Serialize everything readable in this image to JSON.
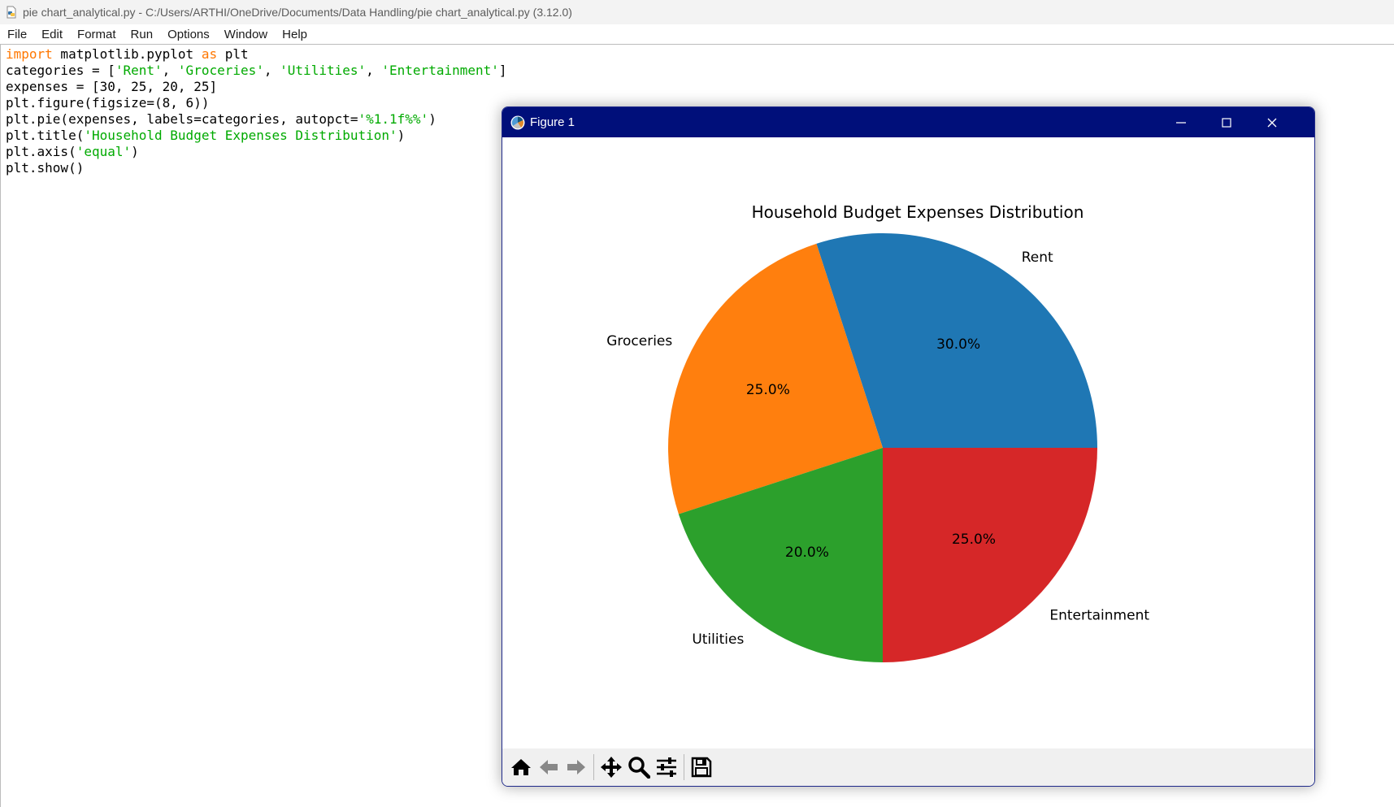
{
  "window": {
    "title": "pie chart_analytical.py - C:/Users/ARTHI/OneDrive/Documents/Data Handling/pie chart_analytical.py (3.12.0)"
  },
  "menu": {
    "items": [
      "File",
      "Edit",
      "Format",
      "Run",
      "Options",
      "Window",
      "Help"
    ]
  },
  "editor": {
    "lines": [
      [
        {
          "t": "import",
          "c": "kw"
        },
        {
          "t": " matplotlib.pyplot ",
          "c": ""
        },
        {
          "t": "as",
          "c": "kw"
        },
        {
          "t": " plt",
          "c": ""
        }
      ],
      [
        {
          "t": "categories = [",
          "c": ""
        },
        {
          "t": "'Rent'",
          "c": "str"
        },
        {
          "t": ", ",
          "c": ""
        },
        {
          "t": "'Groceries'",
          "c": "str"
        },
        {
          "t": ", ",
          "c": ""
        },
        {
          "t": "'Utilities'",
          "c": "str"
        },
        {
          "t": ", ",
          "c": ""
        },
        {
          "t": "'Entertainment'",
          "c": "str"
        },
        {
          "t": "]",
          "c": ""
        }
      ],
      [
        {
          "t": "expenses = [30, 25, 20, 25]",
          "c": ""
        }
      ],
      [
        {
          "t": "plt.figure(figsize=(8, 6))",
          "c": ""
        }
      ],
      [
        {
          "t": "plt.pie(expenses, labels=categories, autopct=",
          "c": ""
        },
        {
          "t": "'%1.1f%%'",
          "c": "str"
        },
        {
          "t": ")",
          "c": ""
        }
      ],
      [
        {
          "t": "plt.title(",
          "c": ""
        },
        {
          "t": "'Household Budget Expenses Distribution'",
          "c": "str"
        },
        {
          "t": ")",
          "c": ""
        }
      ],
      [
        {
          "t": "plt.axis(",
          "c": ""
        },
        {
          "t": "'equal'",
          "c": "str"
        },
        {
          "t": ")",
          "c": ""
        }
      ],
      [
        {
          "t": "plt.show()",
          "c": ""
        }
      ]
    ]
  },
  "figure": {
    "title": "Figure 1",
    "toolbar": [
      "home-icon",
      "back-icon",
      "forward-icon",
      "pan-icon",
      "zoom-icon",
      "configure-subplots-icon",
      "save-icon"
    ]
  },
  "chart_data": {
    "type": "pie",
    "title": "Household Budget Expenses Distribution",
    "categories": [
      "Rent",
      "Groceries",
      "Utilities",
      "Entertainment"
    ],
    "values": [
      30,
      25,
      20,
      25
    ],
    "value_labels": [
      "30.0%",
      "25.0%",
      "20.0%",
      "25.0%"
    ],
    "colors": [
      "#1f77b4",
      "#ff7f0e",
      "#2ca02c",
      "#d62728"
    ],
    "start_angle": 0,
    "direction": "counterclockwise"
  }
}
